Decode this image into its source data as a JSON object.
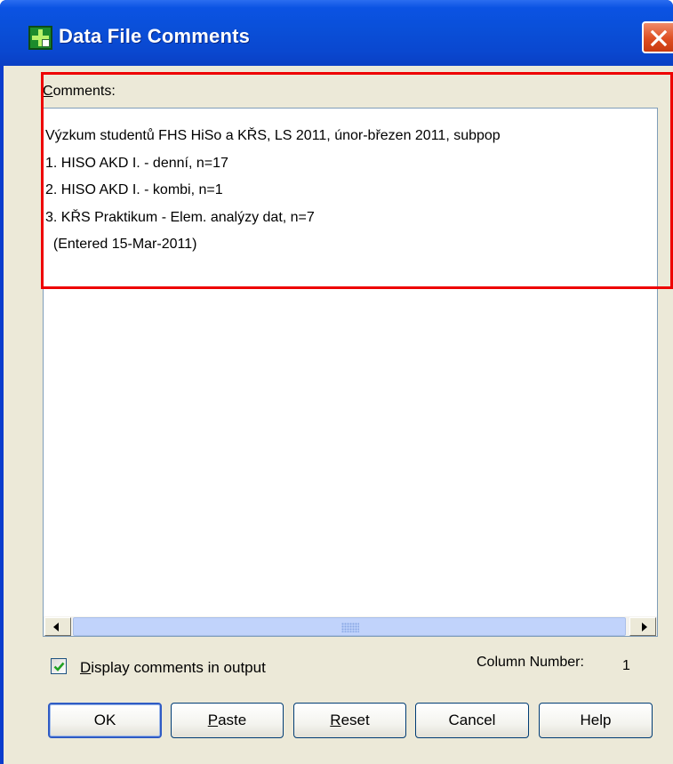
{
  "window": {
    "title": "Data File Comments"
  },
  "comments": {
    "label_first": "C",
    "label_rest": "omments:",
    "lines": [
      "Výzkum studentů FHS HiSo a KŘS, LS 2011, únor-březen 2011, subpop",
      "1. HISO AKD I. - denní, n=17",
      "2. HISO AKD I. - kombi, n=1",
      "3. KŘS Praktikum - Elem. analýzy dat, n=7",
      "  (Entered 15-Mar-2011)"
    ]
  },
  "display_output": {
    "checked": true,
    "label_first": "D",
    "label_rest": "isplay comments in output"
  },
  "column": {
    "label": "Column Number:",
    "value": "1"
  },
  "buttons": {
    "ok": "OK",
    "paste_first": "P",
    "paste_rest": "aste",
    "reset_first": "R",
    "reset_rest": "eset",
    "cancel": "Cancel",
    "help": "Help"
  },
  "colors": {
    "titlebar": "#0a4fd8",
    "dialog_bg": "#ece9d8",
    "highlight": "#ee0000"
  },
  "icons": [
    "spss-app-icon",
    "close-icon",
    "scroll-left-arrow-icon",
    "scroll-right-arrow-icon",
    "checkmark-icon"
  ]
}
